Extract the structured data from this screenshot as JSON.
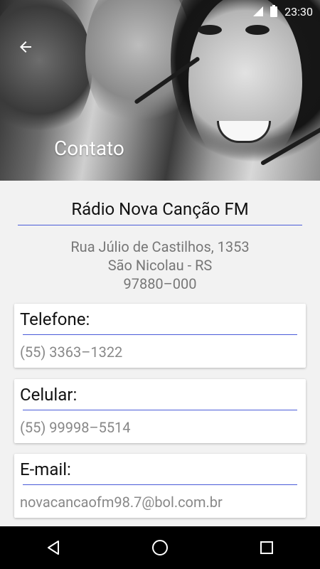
{
  "status_bar": {
    "time": "23:30"
  },
  "header": {
    "title": "Contato"
  },
  "station": {
    "name": "Rádio Nova Canção FM",
    "address_line1": "Rua Júlio de Castilhos, 1353",
    "address_line2": "São Nicolau - RS",
    "address_line3": "97880–000"
  },
  "cards": [
    {
      "label": "Telefone:",
      "value": "(55) 3363–1322"
    },
    {
      "label": "Celular:",
      "value": "(55) 99998–5514"
    },
    {
      "label": "E-mail:",
      "value": "novacancaofm98.7@bol.com.br"
    }
  ],
  "icons": {
    "back": "arrow-left-icon",
    "signal": "signal-icon",
    "battery": "battery-icon",
    "nav_back": "triangle-back-icon",
    "nav_home": "circle-home-icon",
    "nav_recents": "square-recents-icon"
  },
  "colors": {
    "accent_line": "#4a5bd8",
    "nav_bg": "#000000"
  }
}
